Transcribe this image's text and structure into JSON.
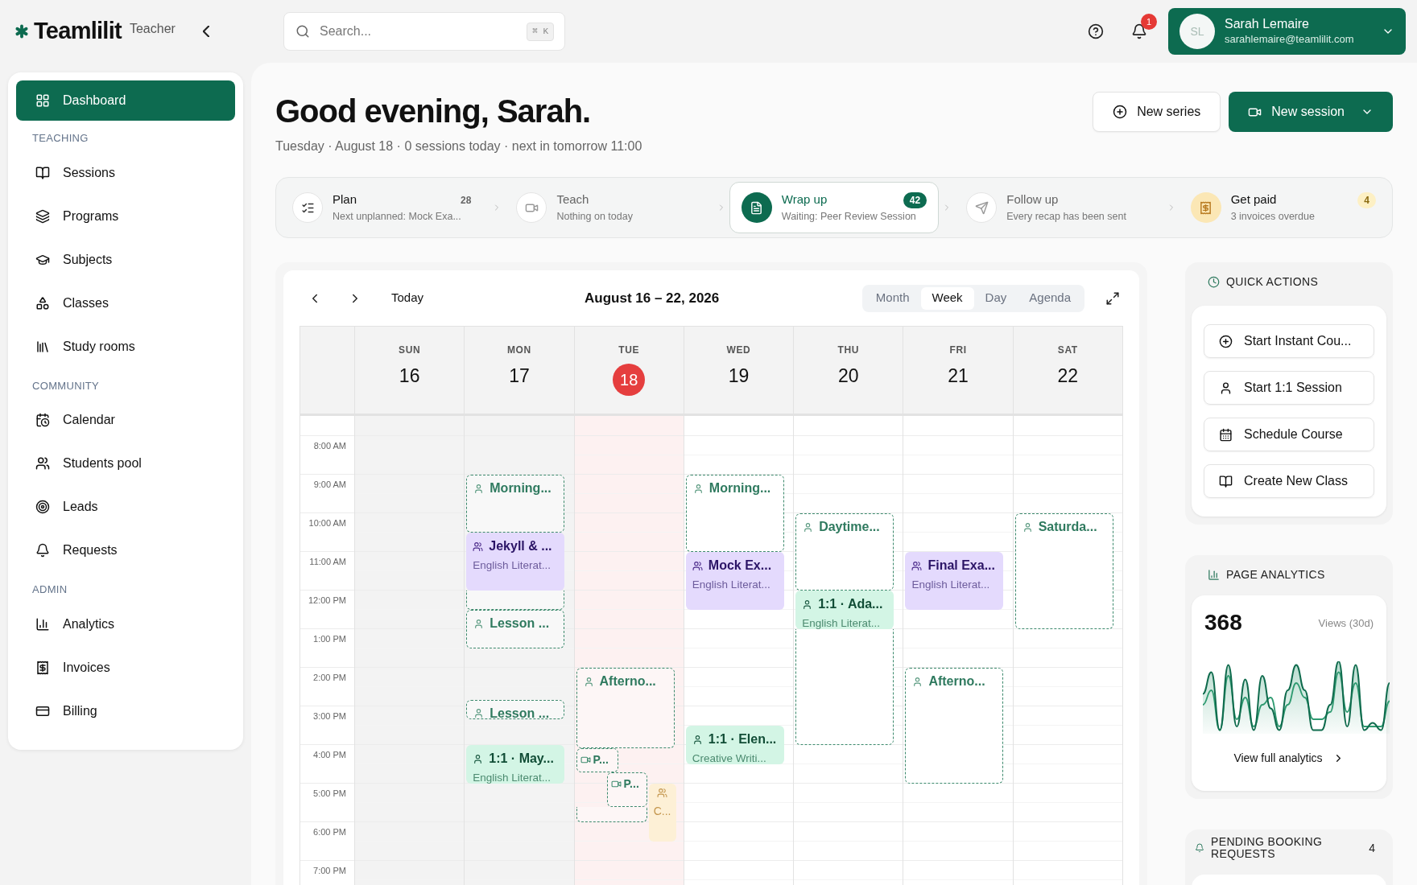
{
  "app": {
    "logo": "Teamlilit",
    "role": "Teacher"
  },
  "search": {
    "placeholder": "Search...",
    "shortcut": "⌘ K"
  },
  "notifications": {
    "count": "1"
  },
  "user": {
    "initials": "SL",
    "name": "Sarah Lemaire",
    "email": "sarahlemaire@teamlilit.com"
  },
  "sidebar": {
    "sections": [
      {
        "items": [
          {
            "label": "Dashboard",
            "selected": true
          }
        ]
      },
      {
        "title": "TEACHING",
        "items": [
          {
            "label": "Sessions",
            "selected": false
          },
          {
            "label": "Programs",
            "selected": false
          },
          {
            "label": "Subjects",
            "selected": false
          },
          {
            "label": "Classes",
            "selected": false
          },
          {
            "label": "Study rooms",
            "selected": false
          }
        ]
      },
      {
        "title": "COMMUNITY",
        "items": [
          {
            "label": "Calendar",
            "selected": false
          },
          {
            "label": "Students pool",
            "selected": false
          },
          {
            "label": "Leads",
            "selected": false
          },
          {
            "label": "Requests",
            "selected": false
          }
        ]
      },
      {
        "title": "ADMIN",
        "items": [
          {
            "label": "Analytics",
            "selected": false
          },
          {
            "label": "Invoices",
            "selected": false
          },
          {
            "label": "Billing",
            "selected": false
          }
        ]
      }
    ]
  },
  "greeting": {
    "title": "Good evening, Sarah.",
    "subtitle": "Tuesday · August 18 · 0 sessions today · next in tomorrow 11:00"
  },
  "actions": [
    {
      "label": "New series",
      "kind": "secondary"
    },
    {
      "label": "New session",
      "kind": "primary"
    }
  ],
  "steps": [
    {
      "title": "Plan",
      "count": "28",
      "subtitle": "Next unplanned: Mock Exa...",
      "selected": false,
      "kind": "plain"
    },
    {
      "title": "Teach",
      "subtitle": "Nothing on today",
      "selected": false,
      "kind": "muted"
    },
    {
      "title": "Wrap up",
      "count": "42",
      "subtitle": "Waiting: Peer Review Session",
      "selected": true,
      "kind": "plain"
    },
    {
      "title": "Follow up",
      "subtitle": "Every recap has been sent",
      "selected": false,
      "kind": "muted"
    },
    {
      "title": "Get paid",
      "count": "4",
      "subtitle": "3 invoices overdue",
      "selected": false,
      "kind": "warning"
    }
  ],
  "calendar": {
    "today_label": "Today",
    "range": "August 16 – 22, 2026",
    "views": [
      {
        "label": "Month",
        "selected": false
      },
      {
        "label": "Week",
        "selected": true
      },
      {
        "label": "Day",
        "selected": false
      },
      {
        "label": "Agenda",
        "selected": false
      }
    ],
    "times": [
      "8:00 AM",
      "9:00 AM",
      "10:00 AM",
      "11:00 AM",
      "12:00 PM",
      "1:00 PM",
      "2:00 PM",
      "3:00 PM",
      "4:00 PM",
      "5:00 PM",
      "6:00 PM",
      "7:00 PM"
    ],
    "days": [
      {
        "name": "SUN",
        "date": "16",
        "today": false,
        "past": true
      },
      {
        "name": "MON",
        "date": "17",
        "today": false,
        "past": true,
        "events": [
          {
            "kind": "open",
            "title": "Morning..."
          },
          {
            "kind": "group",
            "title": "Jekyll & ...",
            "subtitle": "English Literat..."
          },
          {
            "kind": "open",
            "title": "Lesson ..."
          },
          {
            "kind": "open",
            "title": "Lesson ..."
          },
          {
            "kind": "one",
            "title": "1:1 · May...",
            "subtitle": "English Literat..."
          }
        ]
      },
      {
        "name": "TUE",
        "date": "18",
        "today": true,
        "past": false,
        "events": [
          {
            "kind": "open",
            "title": "Afterno..."
          },
          {
            "kind": "video",
            "title": "P..."
          },
          {
            "kind": "video",
            "title": "P..."
          },
          {
            "kind": "pending",
            "title": "C..."
          }
        ]
      },
      {
        "name": "WED",
        "date": "19",
        "today": false,
        "past": false,
        "events": [
          {
            "kind": "open",
            "title": "Morning..."
          },
          {
            "kind": "group",
            "title": "Mock Ex...",
            "subtitle": "English Literat..."
          },
          {
            "kind": "one",
            "title": "1:1 · Elen...",
            "subtitle": "Creative Writi..."
          }
        ]
      },
      {
        "name": "THU",
        "date": "20",
        "today": false,
        "past": false,
        "events": [
          {
            "kind": "open",
            "title": "Daytime..."
          },
          {
            "kind": "one",
            "title": "1:1 · Ada...",
            "subtitle": "English Literat..."
          }
        ]
      },
      {
        "name": "FRI",
        "date": "21",
        "today": false,
        "past": false,
        "events": [
          {
            "kind": "group",
            "title": "Final Exa...",
            "subtitle": "English Literat..."
          },
          {
            "kind": "open",
            "title": "Afterno..."
          }
        ]
      },
      {
        "name": "SAT",
        "date": "22",
        "today": false,
        "past": false,
        "events": [
          {
            "kind": "open",
            "title": "Saturda..."
          }
        ]
      }
    ]
  },
  "quick_actions": {
    "title": "QUICK ACTIONS",
    "items": [
      "Start Instant Cou...",
      "Start 1:1 Session",
      "Schedule Course",
      "Create New Class"
    ]
  },
  "analytics": {
    "title": "PAGE ANALYTICS",
    "value": "368",
    "caption": "Views (30d)",
    "link": "View full analytics"
  },
  "pending": {
    "title": "PENDING BOOKING REQUESTS",
    "count": "4"
  }
}
